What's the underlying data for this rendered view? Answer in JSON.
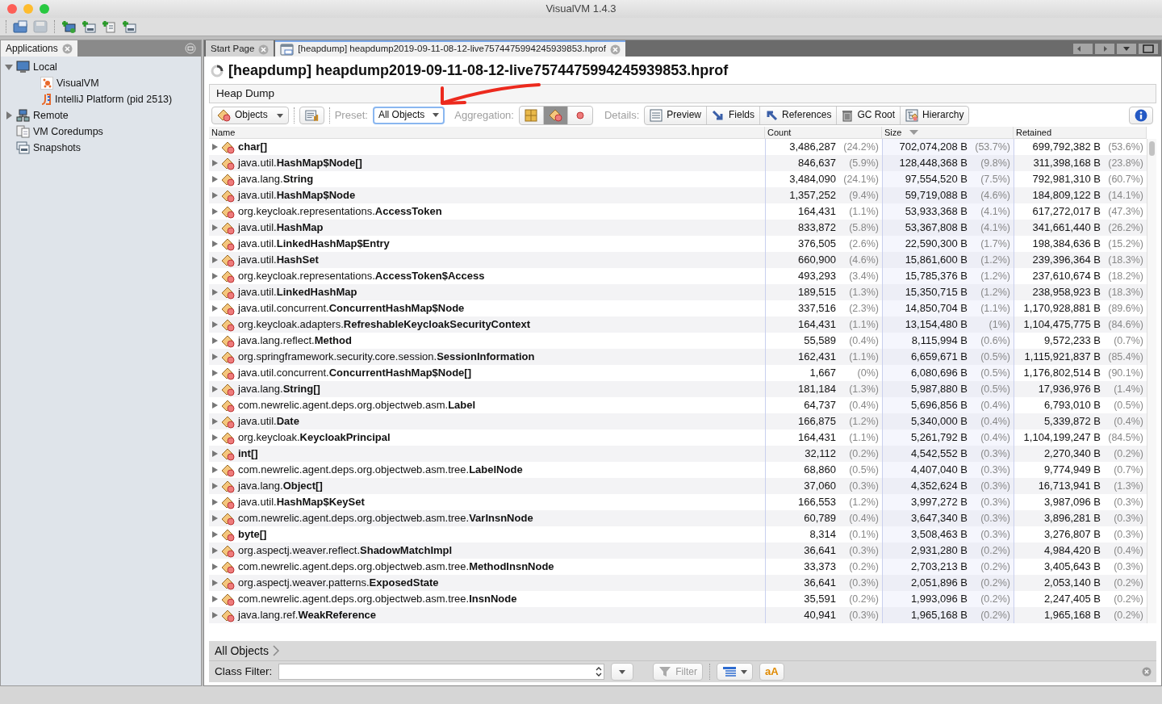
{
  "window": {
    "title": "VisualVM 1.4.3"
  },
  "toolbar": [
    {
      "kind": "open",
      "disabled": false
    },
    {
      "kind": "save",
      "disabled": true
    },
    {
      "kind": "add-host",
      "disabled": false
    },
    {
      "kind": "add-jmx",
      "disabled": false
    },
    {
      "kind": "add-coredump",
      "disabled": false
    },
    {
      "kind": "add-snapshot",
      "disabled": false
    }
  ],
  "sidebar": {
    "tab": "Applications",
    "items": [
      {
        "label": "Local",
        "kind": "host",
        "expanded": true,
        "children": [
          {
            "label": "VisualVM",
            "kind": "visualvm"
          },
          {
            "label": "IntelliJ Platform (pid 2513)",
            "kind": "intellij"
          }
        ]
      },
      {
        "label": "Remote",
        "kind": "remote",
        "expanded": false
      },
      {
        "label": "VM Coredumps",
        "kind": "coredumps"
      },
      {
        "label": "Snapshots",
        "kind": "snapshots"
      }
    ]
  },
  "tabs": [
    {
      "label": "Start Page",
      "kind": "page",
      "selected": false
    },
    {
      "label": "[heapdump] heapdump2019-09-11-08-12-live7574475994245939853.hprof",
      "kind": "heapdump",
      "selected": true
    }
  ],
  "document": {
    "title": "[heapdump] heapdump2019-09-11-08-12-live7574475994245939853.hprof",
    "section": "Heap Dump"
  },
  "view_toolbar": {
    "view": "Objects",
    "preset_label": "Preset:",
    "preset": "All Objects",
    "aggregation_label": "Aggregation:",
    "aggregation": [
      {
        "kind": "packages",
        "selected": false
      },
      {
        "kind": "classes",
        "selected": true
      },
      {
        "kind": "instances",
        "selected": false
      }
    ],
    "details_label": "Details:",
    "details": [
      {
        "label": "Preview",
        "kind": "preview"
      },
      {
        "label": "Fields",
        "kind": "fields"
      },
      {
        "label": "References",
        "kind": "references"
      },
      {
        "label": "GC Root",
        "kind": "gcroot"
      },
      {
        "label": "Hierarchy",
        "kind": "hierarchy"
      }
    ]
  },
  "table": {
    "columns": [
      {
        "label": "Name",
        "sorted": false
      },
      {
        "label": "Count",
        "sorted": false
      },
      {
        "label": "Size",
        "sorted": true
      },
      {
        "label": "Retained",
        "sorted": false
      }
    ],
    "rows": [
      {
        "class": "char[]",
        "count": "3,486,287",
        "count_pct": "(24.2%)",
        "size": "702,074,208 B",
        "size_pct": "(53.7%)",
        "retained": "699,792,382 B",
        "retained_pct": "(53.6%)"
      },
      {
        "package": "java.util.",
        "class": "HashMap$Node[]",
        "count": "846,637",
        "count_pct": "(5.9%)",
        "size": "128,448,368 B",
        "size_pct": "(9.8%)",
        "retained": "311,398,168 B",
        "retained_pct": "(23.8%)"
      },
      {
        "package": "java.lang.",
        "class": "String",
        "count": "3,484,090",
        "count_pct": "(24.1%)",
        "size": "97,554,520 B",
        "size_pct": "(7.5%)",
        "retained": "792,981,310 B",
        "retained_pct": "(60.7%)"
      },
      {
        "package": "java.util.",
        "class": "HashMap$Node",
        "count": "1,357,252",
        "count_pct": "(9.4%)",
        "size": "59,719,088 B",
        "size_pct": "(4.6%)",
        "retained": "184,809,122 B",
        "retained_pct": "(14.1%)"
      },
      {
        "package": "org.keycloak.representations.",
        "class": "AccessToken",
        "count": "164,431",
        "count_pct": "(1.1%)",
        "size": "53,933,368 B",
        "size_pct": "(4.1%)",
        "retained": "617,272,017 B",
        "retained_pct": "(47.3%)"
      },
      {
        "package": "java.util.",
        "class": "HashMap",
        "count": "833,872",
        "count_pct": "(5.8%)",
        "size": "53,367,808 B",
        "size_pct": "(4.1%)",
        "retained": "341,661,440 B",
        "retained_pct": "(26.2%)"
      },
      {
        "package": "java.util.",
        "class": "LinkedHashMap$Entry",
        "count": "376,505",
        "count_pct": "(2.6%)",
        "size": "22,590,300 B",
        "size_pct": "(1.7%)",
        "retained": "198,384,636 B",
        "retained_pct": "(15.2%)"
      },
      {
        "package": "java.util.",
        "class": "HashSet",
        "count": "660,900",
        "count_pct": "(4.6%)",
        "size": "15,861,600 B",
        "size_pct": "(1.2%)",
        "retained": "239,396,364 B",
        "retained_pct": "(18.3%)"
      },
      {
        "package": "org.keycloak.representations.",
        "class": "AccessToken$Access",
        "count": "493,293",
        "count_pct": "(3.4%)",
        "size": "15,785,376 B",
        "size_pct": "(1.2%)",
        "retained": "237,610,674 B",
        "retained_pct": "(18.2%)"
      },
      {
        "package": "java.util.",
        "class": "LinkedHashMap",
        "count": "189,515",
        "count_pct": "(1.3%)",
        "size": "15,350,715 B",
        "size_pct": "(1.2%)",
        "retained": "238,958,923 B",
        "retained_pct": "(18.3%)"
      },
      {
        "package": "java.util.concurrent.",
        "class": "ConcurrentHashMap$Node",
        "count": "337,516",
        "count_pct": "(2.3%)",
        "size": "14,850,704 B",
        "size_pct": "(1.1%)",
        "retained": "1,170,928,881 B",
        "retained_pct": "(89.6%)"
      },
      {
        "package": "org.keycloak.adapters.",
        "class": "RefreshableKeycloakSecurityContext",
        "count": "164,431",
        "count_pct": "(1.1%)",
        "size": "13,154,480 B",
        "size_pct": "(1%)",
        "retained": "1,104,475,775 B",
        "retained_pct": "(84.6%)"
      },
      {
        "package": "java.lang.reflect.",
        "class": "Method",
        "count": "55,589",
        "count_pct": "(0.4%)",
        "size": "8,115,994 B",
        "size_pct": "(0.6%)",
        "retained": "9,572,233 B",
        "retained_pct": "(0.7%)"
      },
      {
        "package": "org.springframework.security.core.session.",
        "class": "SessionInformation",
        "count": "162,431",
        "count_pct": "(1.1%)",
        "size": "6,659,671 B",
        "size_pct": "(0.5%)",
        "retained": "1,115,921,837 B",
        "retained_pct": "(85.4%)"
      },
      {
        "package": "java.util.concurrent.",
        "class": "ConcurrentHashMap$Node[]",
        "count": "1,667",
        "count_pct": "(0%)",
        "size": "6,080,696 B",
        "size_pct": "(0.5%)",
        "retained": "1,176,802,514 B",
        "retained_pct": "(90.1%)"
      },
      {
        "package": "java.lang.",
        "class": "String[]",
        "count": "181,184",
        "count_pct": "(1.3%)",
        "size": "5,987,880 B",
        "size_pct": "(0.5%)",
        "retained": "17,936,976 B",
        "retained_pct": "(1.4%)"
      },
      {
        "package": "com.newrelic.agent.deps.org.objectweb.asm.",
        "class": "Label",
        "count": "64,737",
        "count_pct": "(0.4%)",
        "size": "5,696,856 B",
        "size_pct": "(0.4%)",
        "retained": "6,793,010 B",
        "retained_pct": "(0.5%)"
      },
      {
        "package": "java.util.",
        "class": "Date",
        "count": "166,875",
        "count_pct": "(1.2%)",
        "size": "5,340,000 B",
        "size_pct": "(0.4%)",
        "retained": "5,339,872 B",
        "retained_pct": "(0.4%)"
      },
      {
        "package": "org.keycloak.",
        "class": "KeycloakPrincipal",
        "count": "164,431",
        "count_pct": "(1.1%)",
        "size": "5,261,792 B",
        "size_pct": "(0.4%)",
        "retained": "1,104,199,247 B",
        "retained_pct": "(84.5%)"
      },
      {
        "class": "int[]",
        "count": "32,112",
        "count_pct": "(0.2%)",
        "size": "4,542,552 B",
        "size_pct": "(0.3%)",
        "retained": "2,270,340 B",
        "retained_pct": "(0.2%)"
      },
      {
        "package": "com.newrelic.agent.deps.org.objectweb.asm.tree.",
        "class": "LabelNode",
        "count": "68,860",
        "count_pct": "(0.5%)",
        "size": "4,407,040 B",
        "size_pct": "(0.3%)",
        "retained": "9,774,949 B",
        "retained_pct": "(0.7%)"
      },
      {
        "package": "java.lang.",
        "class": "Object[]",
        "count": "37,060",
        "count_pct": "(0.3%)",
        "size": "4,352,624 B",
        "size_pct": "(0.3%)",
        "retained": "16,713,941 B",
        "retained_pct": "(1.3%)"
      },
      {
        "package": "java.util.",
        "class": "HashMap$KeySet",
        "count": "166,553",
        "count_pct": "(1.2%)",
        "size": "3,997,272 B",
        "size_pct": "(0.3%)",
        "retained": "3,987,096 B",
        "retained_pct": "(0.3%)"
      },
      {
        "package": "com.newrelic.agent.deps.org.objectweb.asm.tree.",
        "class": "VarInsnNode",
        "count": "60,789",
        "count_pct": "(0.4%)",
        "size": "3,647,340 B",
        "size_pct": "(0.3%)",
        "retained": "3,896,281 B",
        "retained_pct": "(0.3%)"
      },
      {
        "class": "byte[]",
        "count": "8,314",
        "count_pct": "(0.1%)",
        "size": "3,508,463 B",
        "size_pct": "(0.3%)",
        "retained": "3,276,807 B",
        "retained_pct": "(0.3%)"
      },
      {
        "package": "org.aspectj.weaver.reflect.",
        "class": "ShadowMatchImpl",
        "count": "36,641",
        "count_pct": "(0.3%)",
        "size": "2,931,280 B",
        "size_pct": "(0.2%)",
        "retained": "4,984,420 B",
        "retained_pct": "(0.4%)"
      },
      {
        "package": "com.newrelic.agent.deps.org.objectweb.asm.tree.",
        "class": "MethodInsnNode",
        "count": "33,373",
        "count_pct": "(0.2%)",
        "size": "2,703,213 B",
        "size_pct": "(0.2%)",
        "retained": "3,405,643 B",
        "retained_pct": "(0.3%)"
      },
      {
        "package": "org.aspectj.weaver.patterns.",
        "class": "ExposedState",
        "count": "36,641",
        "count_pct": "(0.3%)",
        "size": "2,051,896 B",
        "size_pct": "(0.2%)",
        "retained": "2,053,140 B",
        "retained_pct": "(0.2%)"
      },
      {
        "package": "com.newrelic.agent.deps.org.objectweb.asm.tree.",
        "class": "InsnNode",
        "count": "35,591",
        "count_pct": "(0.2%)",
        "size": "1,993,096 B",
        "size_pct": "(0.2%)",
        "retained": "2,247,405 B",
        "retained_pct": "(0.2%)"
      },
      {
        "package": "java.lang.ref.",
        "class": "WeakReference",
        "count": "40,941",
        "count_pct": "(0.3%)",
        "size": "1,965,168 B",
        "size_pct": "(0.2%)",
        "retained": "1,965,168 B",
        "retained_pct": "(0.2%)"
      }
    ]
  },
  "breadcrumb": "All Objects",
  "filter": {
    "label": "Class Filter:",
    "button": "Filter",
    "case_button": "aA"
  }
}
